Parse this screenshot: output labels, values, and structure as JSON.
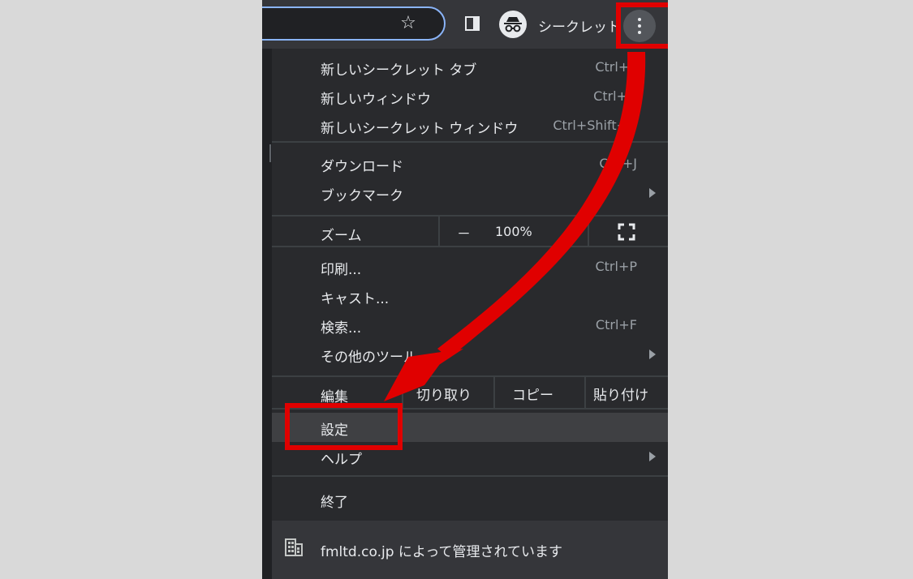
{
  "toolbar": {
    "star_icon": "star-icon",
    "side_panel_icon": "side-panel-icon",
    "incognito_icon": "incognito-icon",
    "incognito_label": "シークレット",
    "menu_icon": "three-dots-vertical-icon"
  },
  "menu": {
    "items": [
      {
        "label": "新しいシークレット タブ",
        "shortcut": "Ctrl+T"
      },
      {
        "label": "新しいウィンドウ",
        "shortcut": "Ctrl+N"
      },
      {
        "label": "新しいシークレット ウィンドウ",
        "shortcut": "Ctrl+Shift+N"
      },
      {
        "label": "ダウンロード",
        "shortcut": "Ctrl+J"
      },
      {
        "label": "ブックマーク",
        "shortcut": ""
      },
      {
        "label": "印刷...",
        "shortcut": "Ctrl+P"
      },
      {
        "label": "キャスト...",
        "shortcut": ""
      },
      {
        "label": "検索...",
        "shortcut": "Ctrl+F"
      },
      {
        "label": "その他のツール",
        "shortcut": ""
      },
      {
        "label": "設定",
        "shortcut": ""
      },
      {
        "label": "ヘルプ",
        "shortcut": ""
      },
      {
        "label": "終了",
        "shortcut": ""
      }
    ],
    "zoom": {
      "label": "ズーム",
      "minus": "－",
      "value": "100%",
      "fullscreen_icon": "fullscreen-icon"
    },
    "edit": {
      "label": "編集",
      "cut": "切り取り",
      "copy": "コピー",
      "paste": "貼り付け"
    },
    "footer": {
      "icon": "building-icon",
      "text": "fmltd.co.jp によって管理されています"
    }
  },
  "annotations": {
    "color": "#e00000"
  },
  "colors": {
    "menu_bg": "#292a2d",
    "toolbar_bg": "#35363a",
    "accent": "#8ab4f8",
    "outer_bg": "#d9d9d9"
  }
}
